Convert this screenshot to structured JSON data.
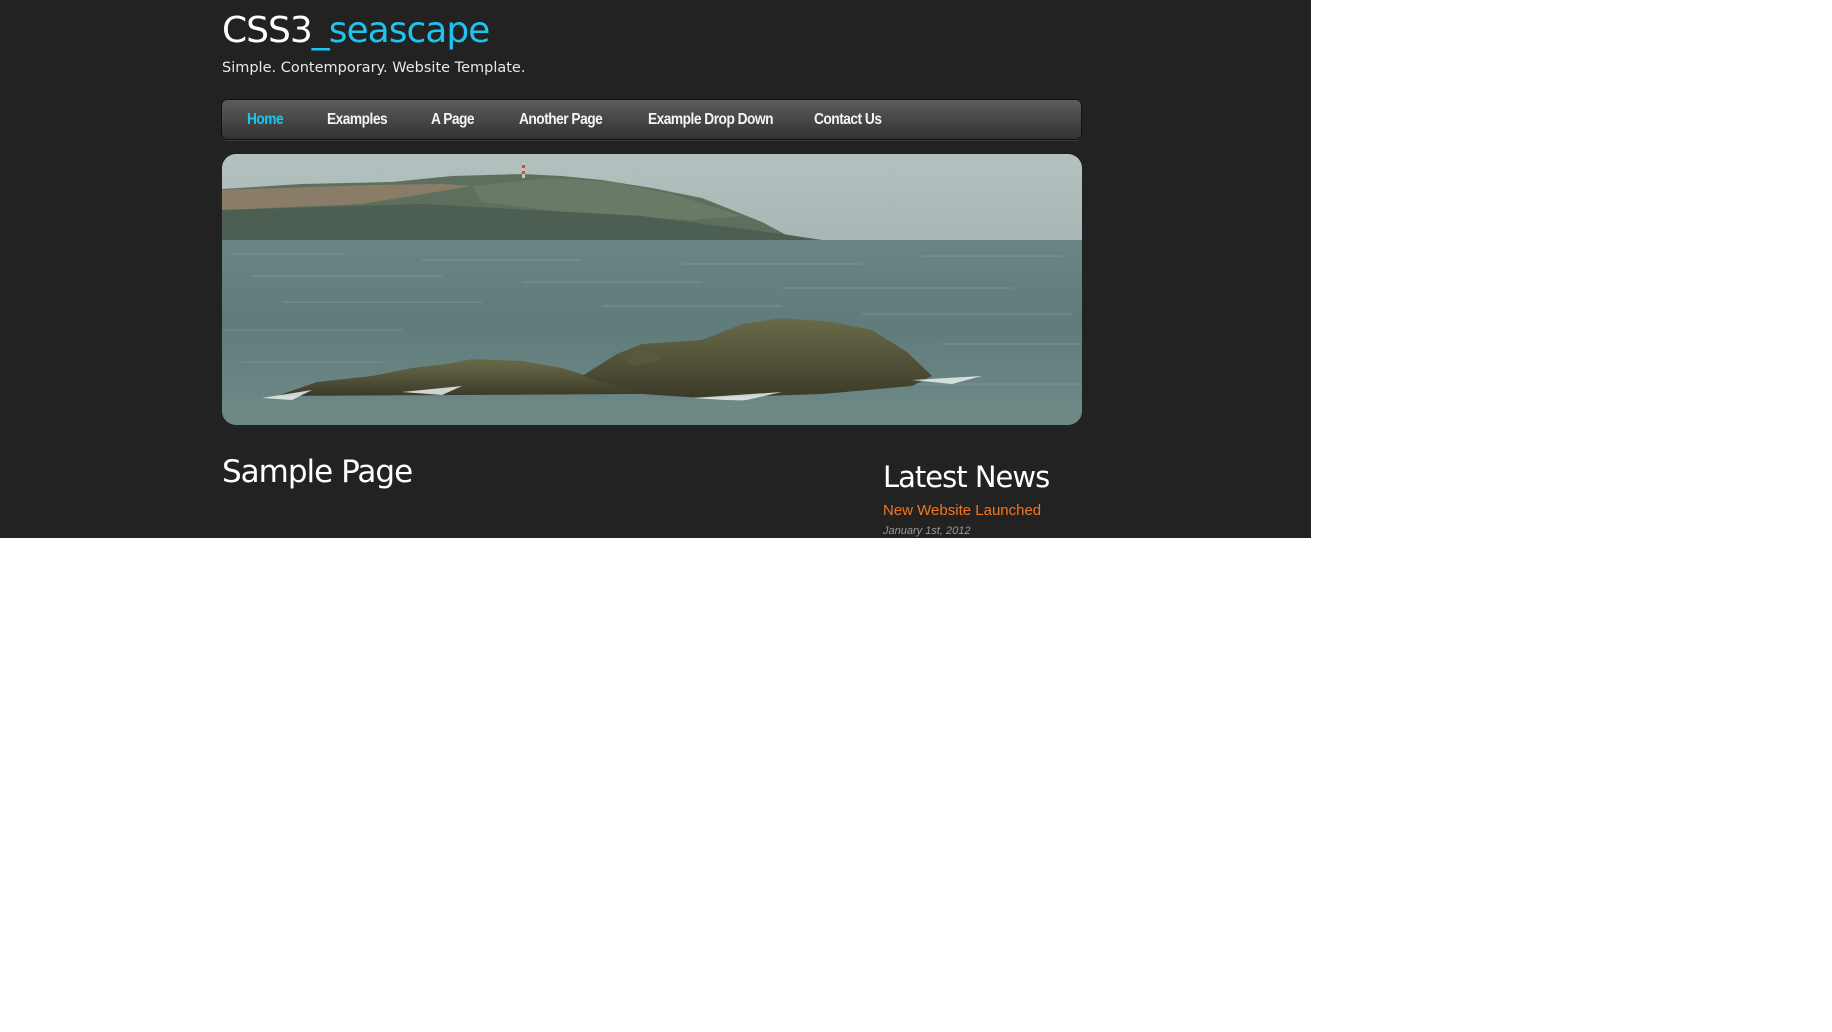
{
  "header": {
    "logo_prefix": "CSS3",
    "logo_accent": "_seascape",
    "tagline": "Simple. Contemporary. Website Template."
  },
  "nav": {
    "items": [
      {
        "label": "Home",
        "active": true
      },
      {
        "label": "Examples",
        "active": false
      },
      {
        "label": "A Page",
        "active": false
      },
      {
        "label": "Another Page",
        "active": false
      },
      {
        "label": "Example Drop Down",
        "active": false
      },
      {
        "label": "Contact Us",
        "active": false
      }
    ]
  },
  "main": {
    "page_title": "Sample Page"
  },
  "sidebar": {
    "heading": "Latest News",
    "news": [
      {
        "title": "New Website Launched",
        "date": "January 1st, 2012"
      }
    ]
  },
  "colors": {
    "background": "#222222",
    "accent": "#1ec3ef",
    "link": "#f37721",
    "text": "#ffffff"
  }
}
